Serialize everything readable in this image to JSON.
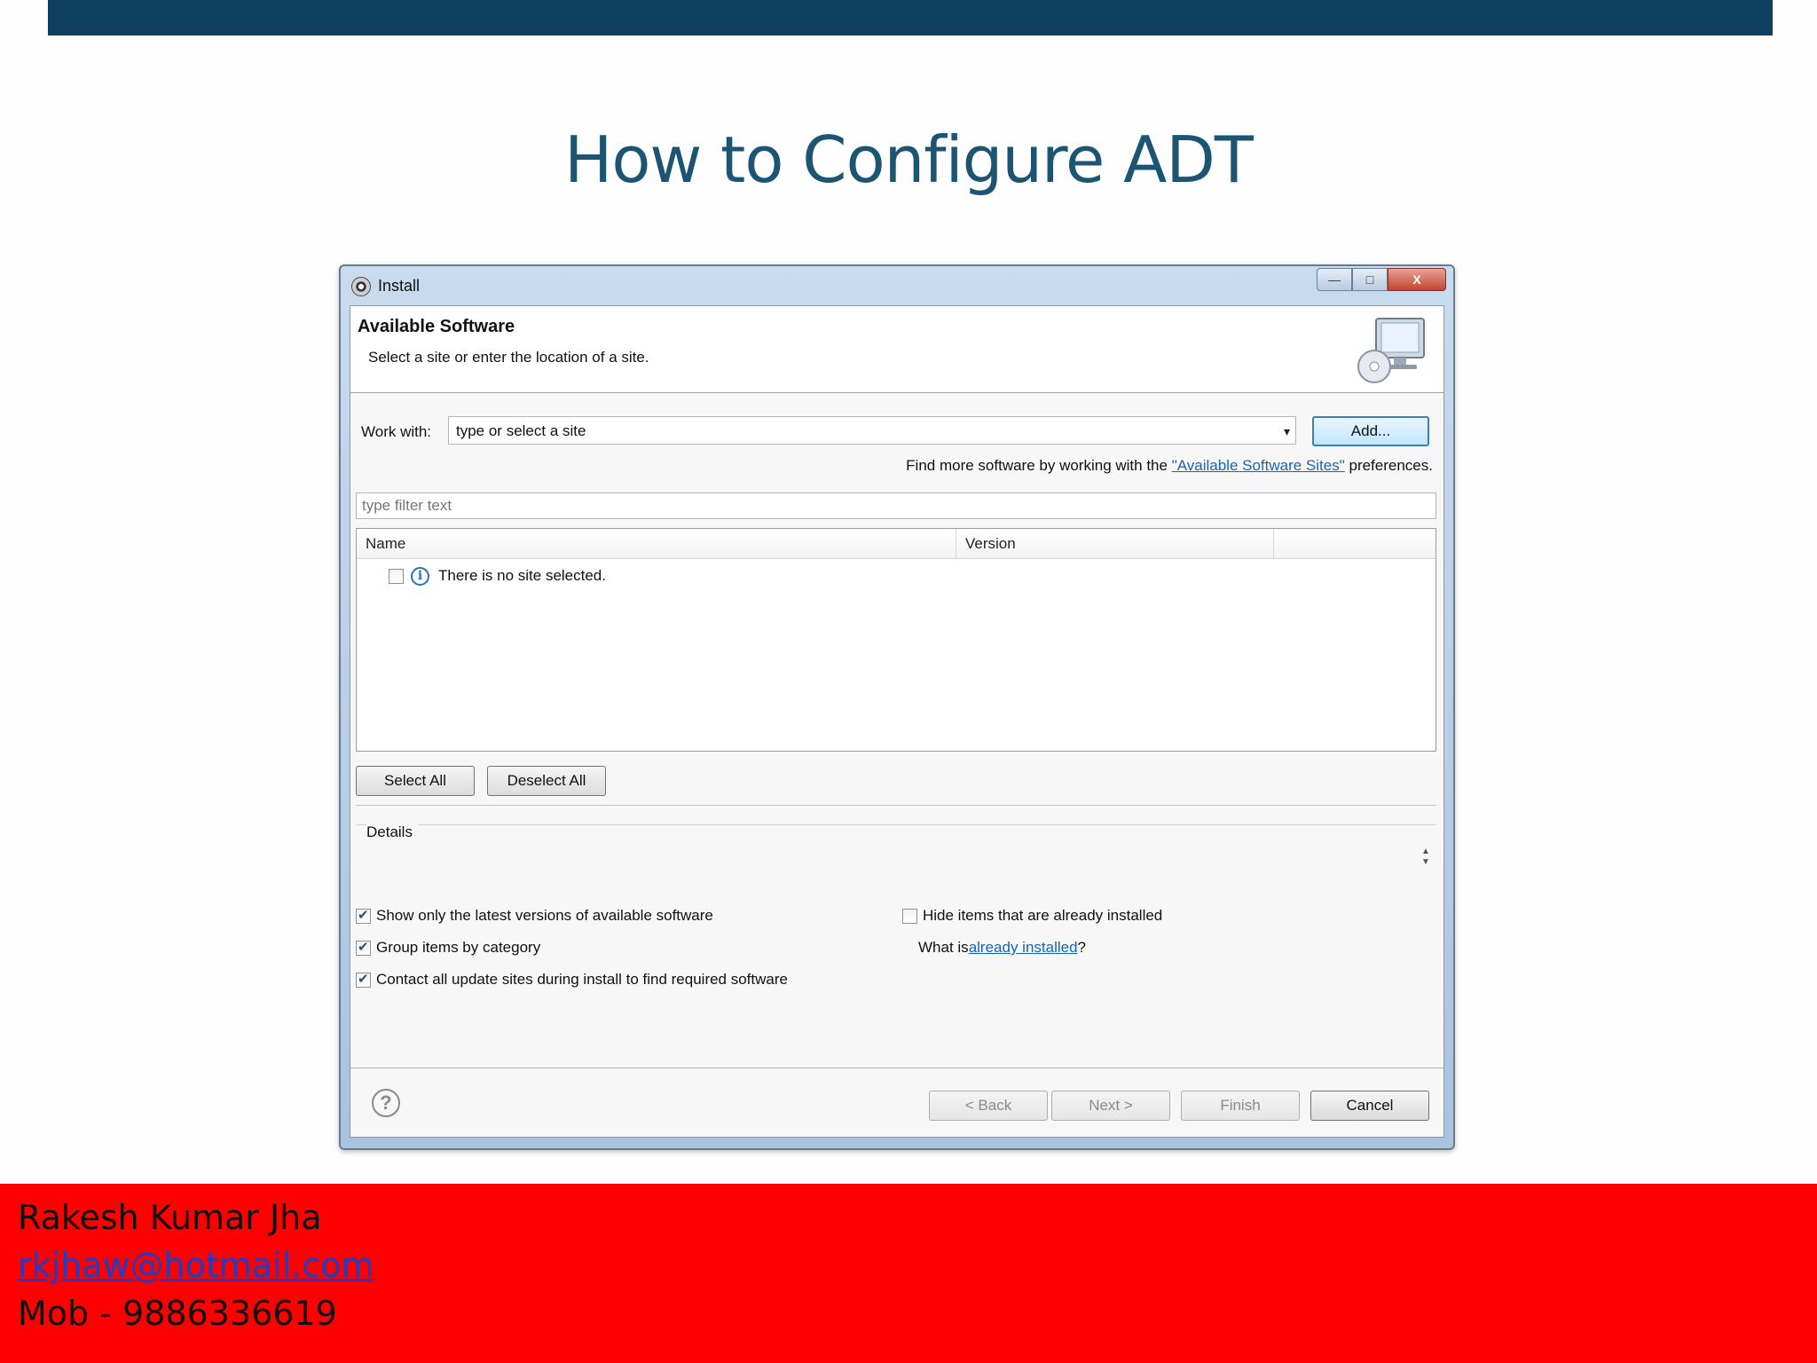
{
  "slide": {
    "title": "How to Configure ADT"
  },
  "window": {
    "title": "Install",
    "app_icon": "eclipse-gear-icon",
    "controls": {
      "minimize": "—",
      "maximize": "□",
      "close": "X"
    }
  },
  "banner": {
    "heading": "Available Software",
    "subtitle": "Select a site or enter the location of a site.",
    "icon": "monitor-cd-icon"
  },
  "work_with": {
    "label": "Work with:",
    "value": "type or select a site",
    "dropdown_icon": "▾",
    "add_button": "Add..."
  },
  "find_more": {
    "prefix": "Find more software by working with the ",
    "link": "\"Available Software Sites\"",
    "suffix": " preferences."
  },
  "filter": {
    "placeholder": "type filter text"
  },
  "table": {
    "columns": [
      "Name",
      "Version"
    ],
    "rows": [
      {
        "checked": false,
        "icon": "info-icon",
        "text": "There is no site selected."
      }
    ]
  },
  "selection_buttons": {
    "select_all": "Select All",
    "deselect_all": "Deselect All"
  },
  "details": {
    "label": "Details"
  },
  "options": {
    "show_latest": {
      "label": "Show only the latest versions of available software",
      "checked": true
    },
    "group_by_category": {
      "label": "Group items by category",
      "checked": true
    },
    "contact_update_sites": {
      "label": "Contact all update sites during install to find required software",
      "checked": true
    },
    "hide_installed": {
      "label": "Hide items that are already installed",
      "checked": false
    },
    "what_is": {
      "prefix": "What is ",
      "link": "already installed",
      "suffix": "?"
    }
  },
  "nav_buttons": {
    "back": "< Back",
    "next": "Next >",
    "finish": "Finish",
    "cancel": "Cancel",
    "help_icon": "?"
  },
  "footer": {
    "name": "Rakesh Kumar Jha",
    "email": "rkjhaw@hotmail.com",
    "mobile": "Mob - 9886336619"
  },
  "colors": {
    "top_bar": "#0e3f61",
    "title_text": "#1b5572",
    "footer_band": "#ff0000",
    "link": "#1565b5"
  }
}
